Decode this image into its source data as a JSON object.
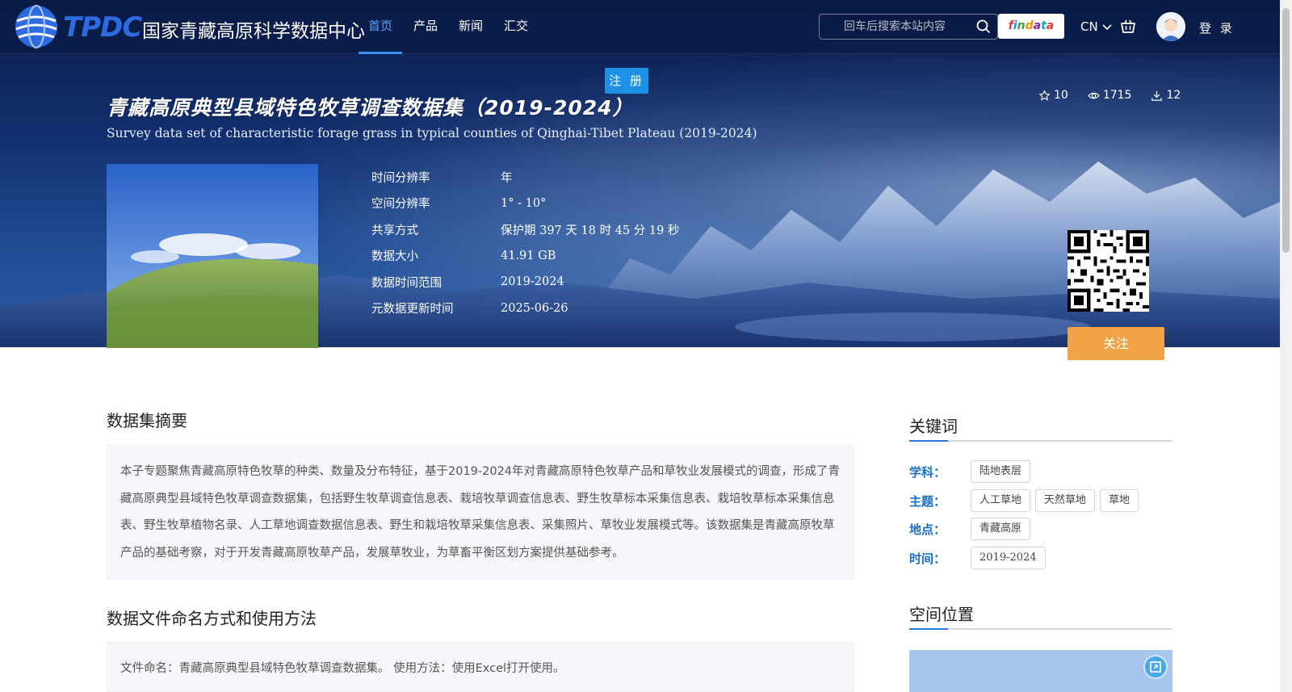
{
  "header": {
    "logo_tpdc": "TPDC",
    "logo_cn": "国家青藏高原科学数据中心",
    "nav": [
      {
        "label": "首页",
        "active": true
      },
      {
        "label": "产品",
        "active": false
      },
      {
        "label": "新闻",
        "active": false
      },
      {
        "label": "汇交",
        "active": false
      }
    ],
    "search_placeholder": "回车后搜索本站内容",
    "findata_label": "findata",
    "lang": "CN",
    "login": "登 录",
    "register_tip": "注 册"
  },
  "dataset": {
    "title_cn": "青藏高原典型县域特色牧草调查数据集（2019-2024）",
    "title_en": "Survey data set of characteristic forage grass in typical counties of Qinghai-Tibet Plateau (2019-2024)",
    "stats": {
      "favorites": "10",
      "views": "1715",
      "downloads": "12"
    },
    "meta": [
      {
        "label": "时间分辨率",
        "value": "年"
      },
      {
        "label": "空间分辨率",
        "value": "1° - 10°"
      },
      {
        "label": "共享方式",
        "value": "保护期 397 天 18 时 45 分 19 秒"
      },
      {
        "label": "数据大小",
        "value": "41.91 GB"
      },
      {
        "label": "数据时间范围",
        "value": "2019-2024"
      },
      {
        "label": "元数据更新时间",
        "value": "2025-06-26"
      }
    ],
    "follow_label": "关注"
  },
  "content": {
    "abstract_title": "数据集摘要",
    "abstract_text": "本子专题聚焦青藏高原特色牧草的种类、数量及分布特征，基于2019-2024年对青藏高原特色牧草产品和草牧业发展模式的调查，形成了青藏高原典型县域特色牧草调查数据集，包括野生牧草调查信息表、栽培牧草调查信息表、野生牧草标本采集信息表、栽培牧草标本采集信息表、野生牧草植物名录、人工草地调查数据信息表、野生和栽培牧草采集信息表、采集照片、草牧业发展模式等。该数据集是青藏高原牧草产品的基础考察，对于开发青藏高原牧草产品，发展草牧业，为草畜平衡区划方案提供基础参考。",
    "naming_title": "数据文件命名方式和使用方法",
    "naming_text": "文件命名：青藏高原典型县域特色牧草调查数据集。 使用方法：使用Excel打开使用。"
  },
  "sidebar": {
    "keywords_title": "关键词",
    "rows": [
      {
        "label": "学科：",
        "tags": [
          "陆地表层"
        ]
      },
      {
        "label": "主题：",
        "tags": [
          "人工草地",
          "天然草地",
          "草地"
        ]
      },
      {
        "label": "地点：",
        "tags": [
          "青藏高原"
        ]
      },
      {
        "label": "时间：",
        "tags": [
          "2019-2024"
        ]
      }
    ],
    "location_title": "空间位置"
  },
  "colors": {
    "accent": "#3b8df5",
    "follow": "#f0a446",
    "keyword_label": "#1a6ec9"
  }
}
